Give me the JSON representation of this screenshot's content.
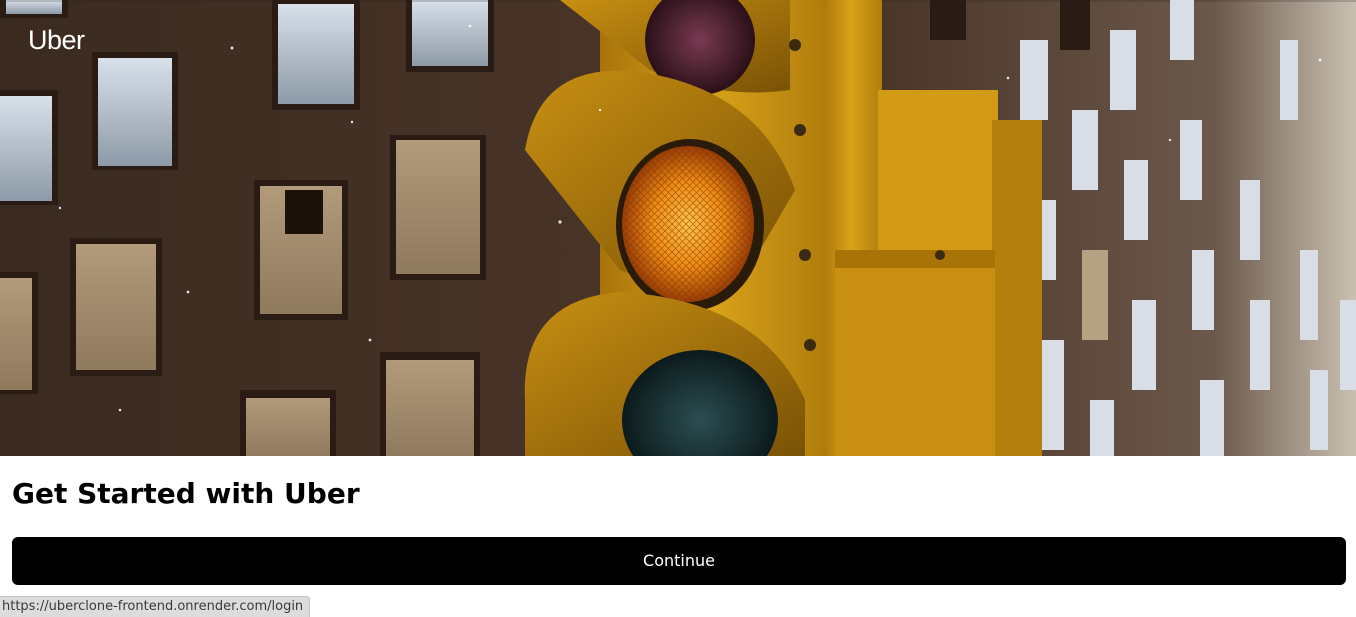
{
  "app": {
    "logo_text": "Uber"
  },
  "hero": {
    "image_subject": "traffic-light-photo",
    "active_signal": "amber"
  },
  "main": {
    "title": "Get Started with Uber",
    "continue_label": "Continue"
  },
  "statusbar": {
    "url": "https://uberclone-frontend.onrender.com/login"
  },
  "colors": {
    "button_bg": "#000000",
    "button_text": "#ffffff",
    "title_text": "#000000",
    "page_bg": "#ffffff",
    "signal_housing": "#d49a12",
    "signal_amber": "#f08c14",
    "building": "#3e2c22"
  }
}
